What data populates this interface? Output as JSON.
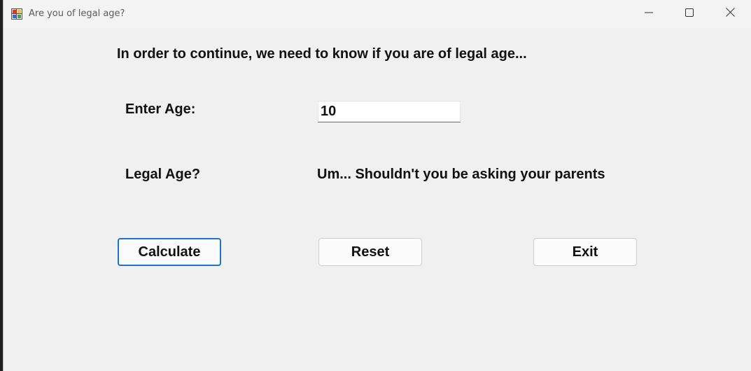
{
  "window": {
    "title": "Are you of legal age?"
  },
  "form": {
    "intro": "In order to continue, we need to know if you are of legal age...",
    "age_label": "Enter Age:",
    "age_value": "10",
    "legal_label": "Legal Age?",
    "result_text": "Um... Shouldn't you be asking your parents"
  },
  "buttons": {
    "calculate": "Calculate",
    "reset": "Reset",
    "exit": "Exit"
  },
  "icons": {
    "app": "app-form-icon",
    "minimize": "minimize-icon",
    "maximize": "maximize-icon",
    "close": "close-icon"
  },
  "colors": {
    "accent": "#1c75c9",
    "background": "#f0f0f0"
  }
}
